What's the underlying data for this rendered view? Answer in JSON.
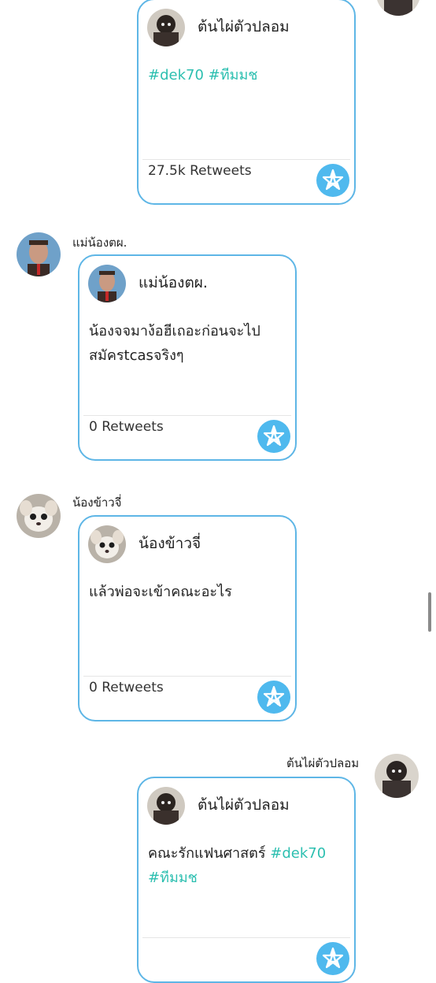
{
  "messages": [
    {
      "side": "right",
      "sender": "",
      "card": {
        "name": "ต้นไผ่ตัวปลอม",
        "text_plain": "",
        "hashtags": "#dek70 #ทีมมช",
        "hashtags_line2": "",
        "retweets": "27.5k Retweets"
      }
    },
    {
      "side": "left",
      "sender": "แม่น้องตผ.",
      "card": {
        "name": "แม่น้องตผ.",
        "text_line1": "น้องจจมาง้อฮีเถอะก่อนจะไป",
        "text_line2": "สมัครtcasจริงๆ",
        "retweets": "0 Retweets"
      }
    },
    {
      "side": "left",
      "sender": "น้องข้าวจี่",
      "card": {
        "name": "น้องข้าวจี่",
        "text_line1": "แล้วพ่อจะเข้าคณะอะไร",
        "retweets": "0 Retweets"
      }
    },
    {
      "side": "right",
      "sender": "ต้นไผ่ตัวปลอม",
      "card": {
        "name": "ต้นไผ่ตัวปลอม",
        "text_plain": "คณะรักแฟนศาสตร์ ",
        "hashtags": "#dek70",
        "hashtags_line2": "#ทีมมช"
      }
    }
  ],
  "colors": {
    "card_border": "#5eb6e6",
    "hashtag": "#2cbfb0",
    "logo_bg": "#4fb9ee"
  },
  "icons": {
    "retweet_logo": "star-a-logo-icon"
  }
}
